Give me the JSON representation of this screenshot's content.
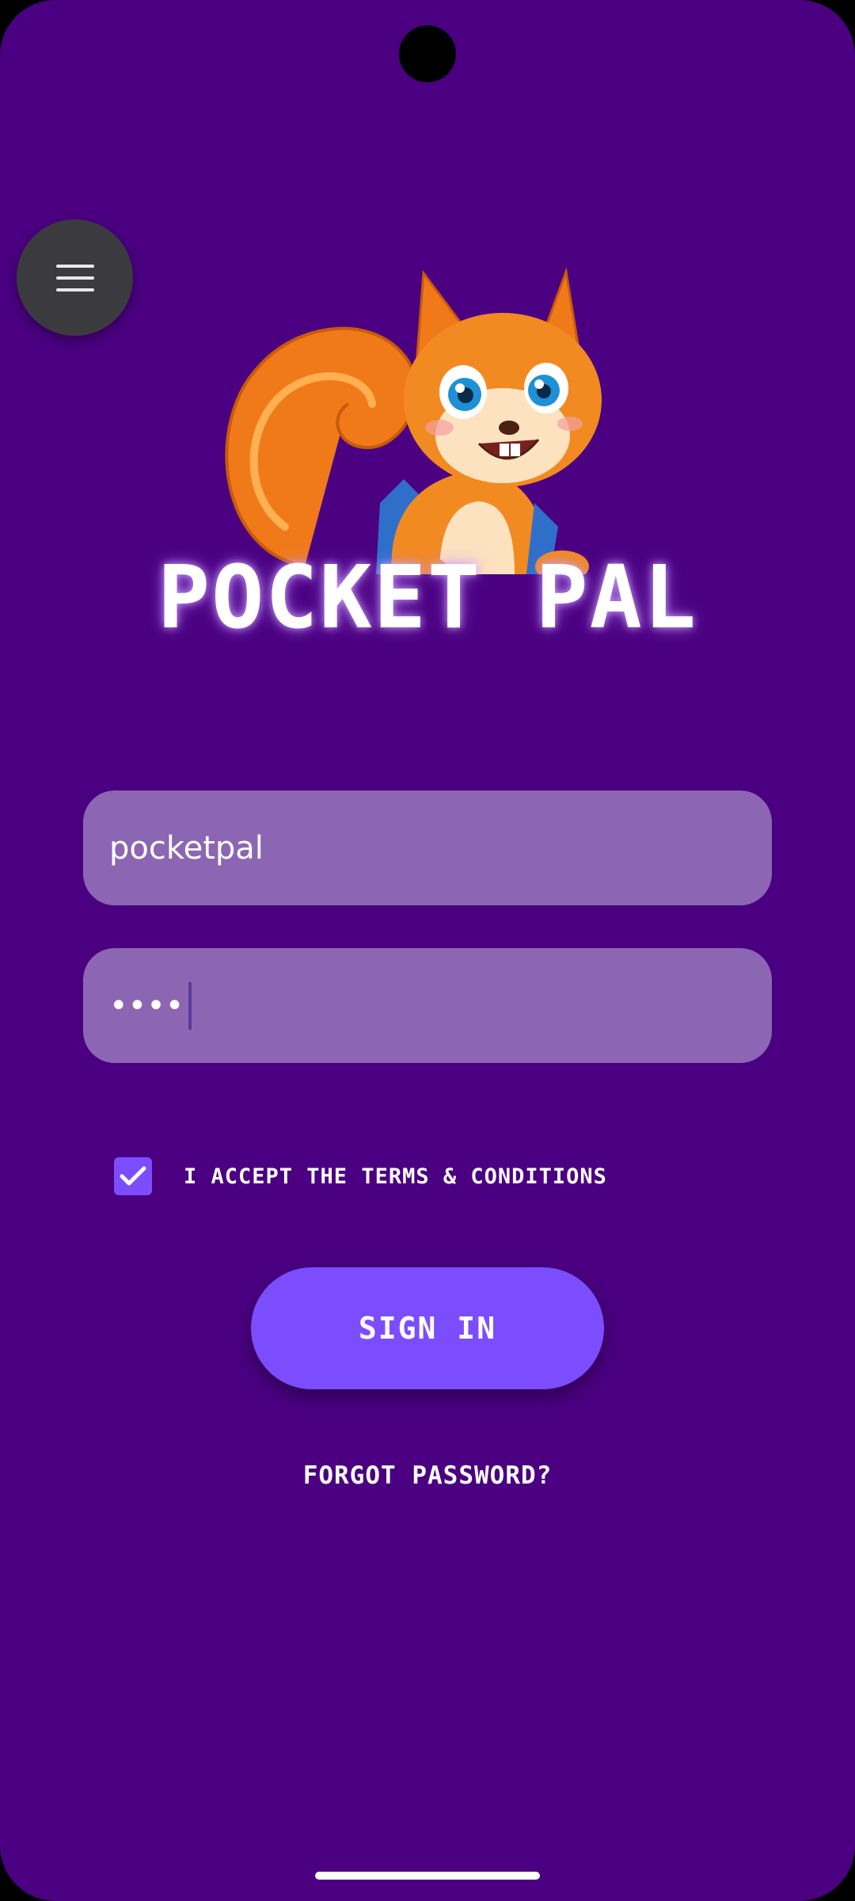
{
  "app": {
    "brand_title": "POCKET PAL",
    "logo_icon": "squirrel-mascot-icon",
    "menu_icon": "hamburger-menu-icon"
  },
  "form": {
    "username_value": "pocketpal",
    "password_masked": "••••",
    "terms_checked": true,
    "terms_label": "I ACCEPT THE TERMS & CONDITIONS",
    "signin_label": "SIGN IN",
    "forgot_label": "FORGOT PASSWORD?"
  },
  "colors": {
    "background": "#4a0081",
    "field": "#8c66b3",
    "accent": "#7c4dff",
    "fab": "#3b3b3f"
  }
}
